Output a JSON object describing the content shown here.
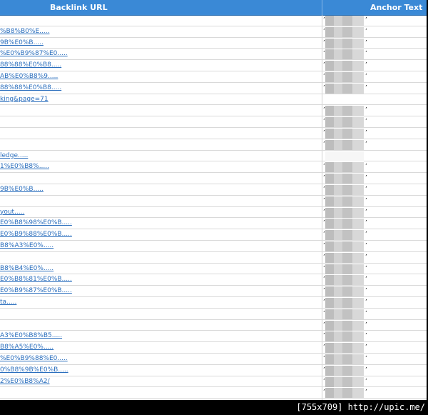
{
  "header": {
    "url_label": "Backlink URL",
    "anchor_label": "Anchor Text"
  },
  "rows": [
    {
      "url": "",
      "blur": "shown"
    },
    {
      "url": "%B8%B0%E.....",
      "blur": "shown"
    },
    {
      "url": "9B%E0%B.....",
      "blur": "shown"
    },
    {
      "url": "%E0%B9%87%E0.....",
      "blur": "shown"
    },
    {
      "url": "88%88%E0%B8.....",
      "blur": "shown"
    },
    {
      "url": "AB%E0%B8%9.....",
      "blur": "shown"
    },
    {
      "url": "88%88%E0%B8.....",
      "blur": "shown"
    },
    {
      "url": "king&page=71",
      "blur": "none"
    },
    {
      "url": "",
      "blur": "shown"
    },
    {
      "url": "",
      "blur": "shown"
    },
    {
      "url": "",
      "blur": "shown"
    },
    {
      "url": "",
      "blur": "shown"
    },
    {
      "url": "ledge.....",
      "blur": "empty"
    },
    {
      "url": "1%E0%B8%.....",
      "blur": "shown"
    },
    {
      "url": "",
      "blur": "shown"
    },
    {
      "url": "9B%E0%B.....",
      "blur": "shown"
    },
    {
      "url": "",
      "blur": "shown"
    },
    {
      "url": "yout.....",
      "blur": "shown"
    },
    {
      "url": "E0%B8%98%E0%B.....",
      "blur": "shown"
    },
    {
      "url": "E0%B9%88%E0%B.....",
      "blur": "shown"
    },
    {
      "url": "B8%A3%E0%.....",
      "blur": "shown"
    },
    {
      "url": "",
      "blur": "shown"
    },
    {
      "url": "B8%B4%E0%.....",
      "blur": "shown"
    },
    {
      "url": "E0%B8%81%E0%B.....",
      "blur": "shown"
    },
    {
      "url": "E0%B9%87%E0%B.....",
      "blur": "shown"
    },
    {
      "url": "ta.....",
      "blur": "shown"
    },
    {
      "url": "",
      "blur": "shown"
    },
    {
      "url": "",
      "blur": "shown"
    },
    {
      "url": "A3%E0%B8%B5.....",
      "blur": "shown"
    },
    {
      "url": "B8%A5%E0%.....",
      "blur": "shown"
    },
    {
      "url": "%E0%B9%88%E0.....",
      "blur": "shown"
    },
    {
      "url": "0%B8%9B%E0%B.....",
      "blur": "shown"
    },
    {
      "url": "2%E0%B8%A2/",
      "blur": "shown"
    },
    {
      "url": "",
      "blur": "shown"
    }
  ],
  "footer": {
    "text": "[755x709] http://upic.me/"
  },
  "colors": {
    "header_bg": "#3a89d6",
    "link": "#2a6ebd",
    "footer_bg": "#000000"
  }
}
